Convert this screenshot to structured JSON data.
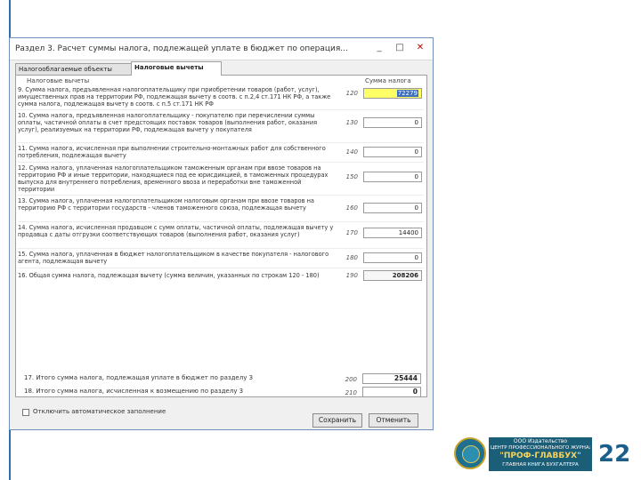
{
  "window": {
    "title": "Раздел 3. Расчет суммы налога, подлежащей уплате в бюджет по операция...",
    "controls": [
      "_",
      "□",
      "✕"
    ]
  },
  "tabs": [
    {
      "label": "Налогооблагаемые объекты",
      "active": false
    },
    {
      "label": "Налоговые вычеты",
      "active": true
    }
  ],
  "columns": {
    "deductions": "Налоговые вычеты",
    "amount": "Сумма налога"
  },
  "rows": [
    {
      "text": "9. Сумма налога, предъявленная налогоплательщику при приобретении товаров (работ, услуг), имущественных прав на территории РФ, подлежащая вычету в соотв. с п.2,4 ст.171 НК РФ, а также сумма налога, подлежащая вычету в соотв. с п.5 ст.171 НК РФ",
      "code": "120",
      "value": "72279",
      "highlight": true
    },
    {
      "text": "10. Сумма налога, предъявленная налогоплательщику - покупателю при перечислении суммы оплаты, частичной оплаты в счет предстоящих поставок товаров (выполнения работ, оказания услуг), реализуемых на территории РФ, подлежащая вычету у покупателя",
      "code": "130",
      "value": "0"
    },
    {
      "text": "11. Сумма налога, исчисленная при выполнении строительно-монтажных работ для собственного потребления, подлежащая вычету",
      "code": "140",
      "value": "0"
    },
    {
      "text": "12. Сумма налога, уплаченная налогоплательщиком таможенным органам при ввозе товаров на территорию РФ и иные территории, находящиеся под ее юрисдикцией, в таможенных процедурах выпуска для внутреннего потребления, временного ввоза и переработки вне таможенной территории",
      "code": "150",
      "value": "0"
    },
    {
      "text": "13. Сумма налога, уплаченная налогоплательщиком налоговым органам при ввозе товаров на территорию РФ с территории государств - членов таможенного союза, подлежащая вычету",
      "code": "160",
      "value": "0"
    },
    {
      "text": "14. Сумма налога, исчисленная продавцом с сумм оплаты, частичной оплаты, подлежащая вычету у продавца с даты отгрузки соответствующих товаров (выполнения работ, оказания услуг)",
      "code": "170",
      "value": "14400"
    },
    {
      "text": "15. Сумма налога, уплаченная в бюджет налогоплательщиком в качестве покупателя - налогового агента, подлежащая вычету",
      "code": "180",
      "value": "0"
    },
    {
      "text": "16. Общая сумма налога, подлежащая вычету (сумма величин, указанных по строкам 120 - 180)",
      "code": "190",
      "value": "208206",
      "total": true
    }
  ],
  "summary": [
    {
      "text": "17. Итого сумма налога, подлежащая уплате в бюджет по разделу 3",
      "code": "200",
      "value": "25444"
    },
    {
      "text": "18. Итого сумма налога, исчисленная к возмещению по разделу 3",
      "code": "210",
      "value": "0"
    }
  ],
  "checkbox_label": "Отключить автоматическое заполнение",
  "buttons": {
    "save": "Сохранить",
    "cancel": "Отменить"
  },
  "branding": {
    "line1": "ООО Издательство",
    "line2": "ЦЕНТР ПРОФЕССИОНАЛЬНОГО ЖУРНАЛА",
    "line3": "\"ПРОФ-ГЛАВБУХ\"",
    "line4": "ГЛАВНАЯ КНИГА БУХГАЛТЕРА",
    "page_number": "22"
  }
}
